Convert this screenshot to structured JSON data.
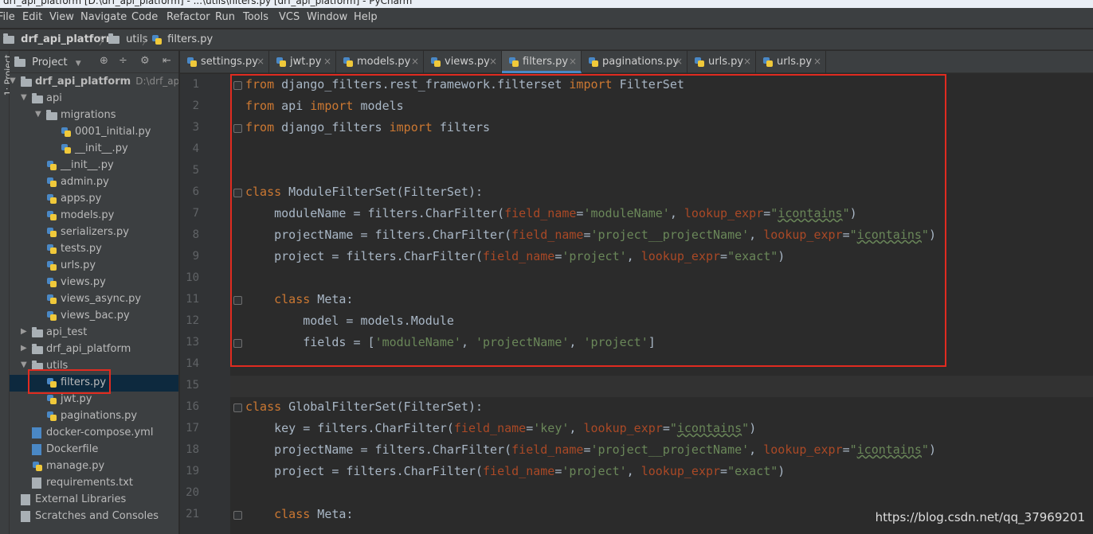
{
  "window": {
    "title": "drf_api_platform [D:\\drf_api_platform] - ...\\utils\\filters.py [drf_api_platform] - PyCharm"
  },
  "menu": [
    "File",
    "Edit",
    "View",
    "Navigate",
    "Code",
    "Refactor",
    "Run",
    "Tools",
    "VCS",
    "Window",
    "Help"
  ],
  "breadcrumb": {
    "project": "drf_api_platform",
    "folder": "utils",
    "file": "filters.py"
  },
  "side_strip": {
    "label": "1: Project"
  },
  "project_panel": {
    "header": "Project",
    "tools": [
      "⊕",
      "÷",
      "⚙",
      "⇤"
    ],
    "tree": [
      {
        "label": "drf_api_platform",
        "path": "D:\\drf_api_platf",
        "depth": 0,
        "icon": "folder-icon",
        "arrow": "▼"
      },
      {
        "label": "api",
        "depth": 1,
        "icon": "folder-icon",
        "arrow": "▼"
      },
      {
        "label": "migrations",
        "depth": 2,
        "icon": "folder-icon",
        "arrow": "▼"
      },
      {
        "label": "0001_initial.py",
        "depth": 3,
        "icon": "python-file-icon"
      },
      {
        "label": "__init__.py",
        "depth": 3,
        "icon": "python-file-icon"
      },
      {
        "label": "__init__.py",
        "depth": 2,
        "icon": "python-file-icon"
      },
      {
        "label": "admin.py",
        "depth": 2,
        "icon": "python-file-icon"
      },
      {
        "label": "apps.py",
        "depth": 2,
        "icon": "python-file-icon"
      },
      {
        "label": "models.py",
        "depth": 2,
        "icon": "python-file-icon"
      },
      {
        "label": "serializers.py",
        "depth": 2,
        "icon": "python-file-icon"
      },
      {
        "label": "tests.py",
        "depth": 2,
        "icon": "python-file-icon"
      },
      {
        "label": "urls.py",
        "depth": 2,
        "icon": "python-file-icon"
      },
      {
        "label": "views.py",
        "depth": 2,
        "icon": "python-file-icon"
      },
      {
        "label": "views_async.py",
        "depth": 2,
        "icon": "python-file-icon"
      },
      {
        "label": "views_bac.py",
        "depth": 2,
        "icon": "python-file-icon"
      },
      {
        "label": "api_test",
        "depth": 1,
        "icon": "folder-icon",
        "arrow": "▶"
      },
      {
        "label": "drf_api_platform",
        "depth": 1,
        "icon": "folder-icon",
        "arrow": "▶"
      },
      {
        "label": "utils",
        "depth": 1,
        "icon": "folder-icon",
        "arrow": "▼"
      },
      {
        "label": "filters.py",
        "depth": 2,
        "icon": "python-file-icon",
        "selected": true
      },
      {
        "label": "jwt.py",
        "depth": 2,
        "icon": "python-file-icon"
      },
      {
        "label": "paginations.py",
        "depth": 2,
        "icon": "python-file-icon"
      },
      {
        "label": "docker-compose.yml",
        "depth": 1,
        "icon": "docker-file-icon"
      },
      {
        "label": "Dockerfile",
        "depth": 1,
        "icon": "docker-file-icon"
      },
      {
        "label": "manage.py",
        "depth": 1,
        "icon": "python-file-icon"
      },
      {
        "label": "requirements.txt",
        "depth": 1,
        "icon": "text-file-icon"
      },
      {
        "label": "External Libraries",
        "depth": 0,
        "icon": "library-icon"
      },
      {
        "label": "Scratches and Consoles",
        "depth": 0,
        "icon": "scratch-icon"
      }
    ]
  },
  "tabs": [
    {
      "label": "settings.py",
      "active": false
    },
    {
      "label": "jwt.py",
      "active": false
    },
    {
      "label": "models.py",
      "active": false
    },
    {
      "label": "views.py",
      "active": false
    },
    {
      "label": "filters.py",
      "active": true
    },
    {
      "label": "paginations.py",
      "active": false
    },
    {
      "label": "urls.py",
      "active": false
    },
    {
      "label": "urls.py",
      "active": false
    }
  ],
  "editor": {
    "current_line": 15,
    "lines": [
      {
        "n": "1",
        "fold": true,
        "tokens": [
          [
            "kw",
            "from"
          ],
          [
            "t",
            " django_filters.rest_framework.filterset "
          ],
          [
            "kw",
            "import"
          ],
          [
            "t",
            " FilterSet"
          ]
        ]
      },
      {
        "n": "2",
        "tokens": [
          [
            "kw",
            "from"
          ],
          [
            "t",
            " api "
          ],
          [
            "kw",
            "import"
          ],
          [
            "t",
            " models"
          ]
        ]
      },
      {
        "n": "3",
        "fold": true,
        "tokens": [
          [
            "kw",
            "from"
          ],
          [
            "t",
            " django_filters "
          ],
          [
            "kw",
            "import"
          ],
          [
            "t",
            " filters"
          ]
        ]
      },
      {
        "n": "4",
        "tokens": []
      },
      {
        "n": "5",
        "tokens": []
      },
      {
        "n": "6",
        "fold": true,
        "tokens": [
          [
            "kw",
            "class"
          ],
          [
            "t",
            " ModuleFilterSet(FilterSet):"
          ]
        ]
      },
      {
        "n": "7",
        "tokens": [
          [
            "t",
            "    moduleName = filters.CharFilter("
          ],
          [
            "prm",
            "field_name"
          ],
          [
            "t",
            "="
          ],
          [
            "str",
            "'moduleName'"
          ],
          [
            "t",
            ", "
          ],
          [
            "prm",
            "lookup_expr"
          ],
          [
            "t",
            "="
          ],
          [
            "str",
            "\""
          ],
          [
            "und",
            "icontains"
          ],
          [
            "str",
            "\""
          ],
          [
            "t",
            ")"
          ]
        ]
      },
      {
        "n": "8",
        "tokens": [
          [
            "t",
            "    projectName = filters.CharFilter("
          ],
          [
            "prm",
            "field_name"
          ],
          [
            "t",
            "="
          ],
          [
            "str",
            "'project__projectName'"
          ],
          [
            "t",
            ", "
          ],
          [
            "prm",
            "lookup_expr"
          ],
          [
            "t",
            "="
          ],
          [
            "str",
            "\""
          ],
          [
            "und",
            "icontains"
          ],
          [
            "str",
            "\""
          ],
          [
            "t",
            ")"
          ]
        ]
      },
      {
        "n": "9",
        "tokens": [
          [
            "t",
            "    project = filters.CharFilter("
          ],
          [
            "prm",
            "field_name"
          ],
          [
            "t",
            "="
          ],
          [
            "str",
            "'project'"
          ],
          [
            "t",
            ", "
          ],
          [
            "prm",
            "lookup_expr"
          ],
          [
            "t",
            "="
          ],
          [
            "str",
            "\"exact\""
          ],
          [
            "t",
            ")"
          ]
        ]
      },
      {
        "n": "10",
        "tokens": []
      },
      {
        "n": "11",
        "fold": true,
        "tokens": [
          [
            "t",
            "    "
          ],
          [
            "kw",
            "class"
          ],
          [
            "t",
            " Meta:"
          ]
        ]
      },
      {
        "n": "12",
        "tokens": [
          [
            "t",
            "        model = models.Module"
          ]
        ]
      },
      {
        "n": "13",
        "fold": true,
        "tokens": [
          [
            "t",
            "        fields = ["
          ],
          [
            "str",
            "'moduleName'"
          ],
          [
            "t",
            ", "
          ],
          [
            "str",
            "'projectName'"
          ],
          [
            "t",
            ", "
          ],
          [
            "str",
            "'project'"
          ],
          [
            "t",
            "]"
          ]
        ]
      },
      {
        "n": "14",
        "tokens": []
      },
      {
        "n": "15",
        "tokens": []
      },
      {
        "n": "16",
        "fold": true,
        "tokens": [
          [
            "kw",
            "class"
          ],
          [
            "t",
            " GlobalFilterSet(FilterSet):"
          ]
        ]
      },
      {
        "n": "17",
        "tokens": [
          [
            "t",
            "    key = filters.CharFilter("
          ],
          [
            "prm",
            "field_name"
          ],
          [
            "t",
            "="
          ],
          [
            "str",
            "'key'"
          ],
          [
            "t",
            ", "
          ],
          [
            "prm",
            "lookup_expr"
          ],
          [
            "t",
            "="
          ],
          [
            "str",
            "\""
          ],
          [
            "und",
            "icontains"
          ],
          [
            "str",
            "\""
          ],
          [
            "t",
            ")"
          ]
        ]
      },
      {
        "n": "18",
        "tokens": [
          [
            "t",
            "    projectName = filters.CharFilter("
          ],
          [
            "prm",
            "field_name"
          ],
          [
            "t",
            "="
          ],
          [
            "str",
            "'project__projectName'"
          ],
          [
            "t",
            ", "
          ],
          [
            "prm",
            "lookup_expr"
          ],
          [
            "t",
            "="
          ],
          [
            "str",
            "\""
          ],
          [
            "und",
            "icontains"
          ],
          [
            "str",
            "\""
          ],
          [
            "t",
            ")"
          ]
        ]
      },
      {
        "n": "19",
        "tokens": [
          [
            "t",
            "    project = filters.CharFilter("
          ],
          [
            "prm",
            "field_name"
          ],
          [
            "t",
            "="
          ],
          [
            "str",
            "'project'"
          ],
          [
            "t",
            ", "
          ],
          [
            "prm",
            "lookup_expr"
          ],
          [
            "t",
            "="
          ],
          [
            "str",
            "\"exact\""
          ],
          [
            "t",
            ")"
          ]
        ]
      },
      {
        "n": "20",
        "tokens": []
      },
      {
        "n": "21",
        "fold": true,
        "tokens": [
          [
            "t",
            "    "
          ],
          [
            "kw",
            "class"
          ],
          [
            "t",
            " Meta:"
          ]
        ]
      }
    ]
  },
  "watermark": "https://blog.csdn.net/qq_37969201",
  "colors": {
    "keyword": "#cc7832",
    "string": "#6a8759",
    "param": "#aa4926",
    "text": "#a9b7c6",
    "highlight_box": "#e02b20"
  }
}
